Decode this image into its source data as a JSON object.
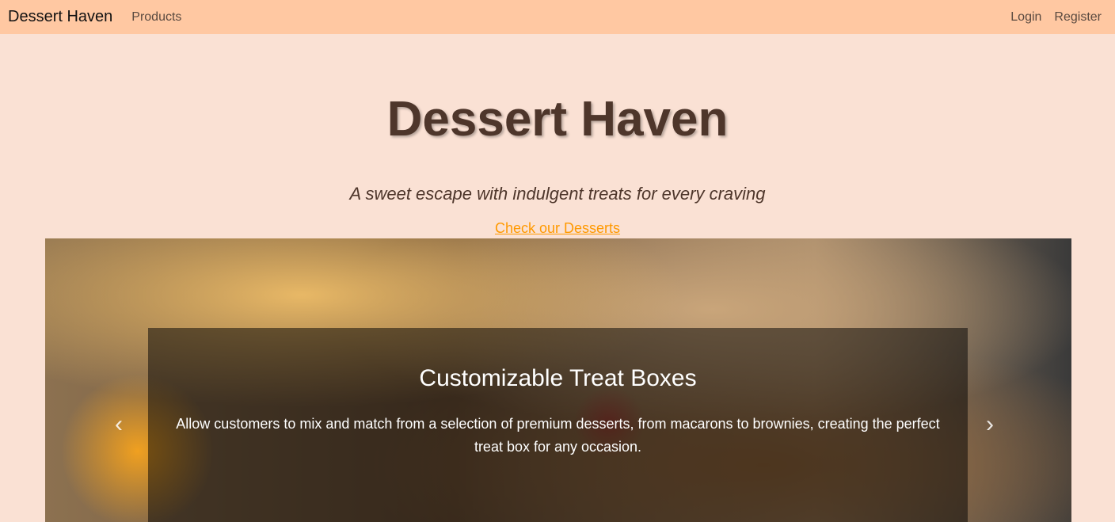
{
  "nav": {
    "brand": "Dessert Haven",
    "products": "Products",
    "login": "Login",
    "register": "Register"
  },
  "hero": {
    "title": "Dessert Haven",
    "subtitle": "A sweet escape with indulgent treats for every craving",
    "cta": "Check our Desserts"
  },
  "carousel": {
    "title": "Customizable Treat Boxes",
    "text": "Allow customers to mix and match from a selection of premium desserts, from macarons to brownies, creating the perfect treat box for any occasion.",
    "prev": "‹",
    "next": "›"
  }
}
